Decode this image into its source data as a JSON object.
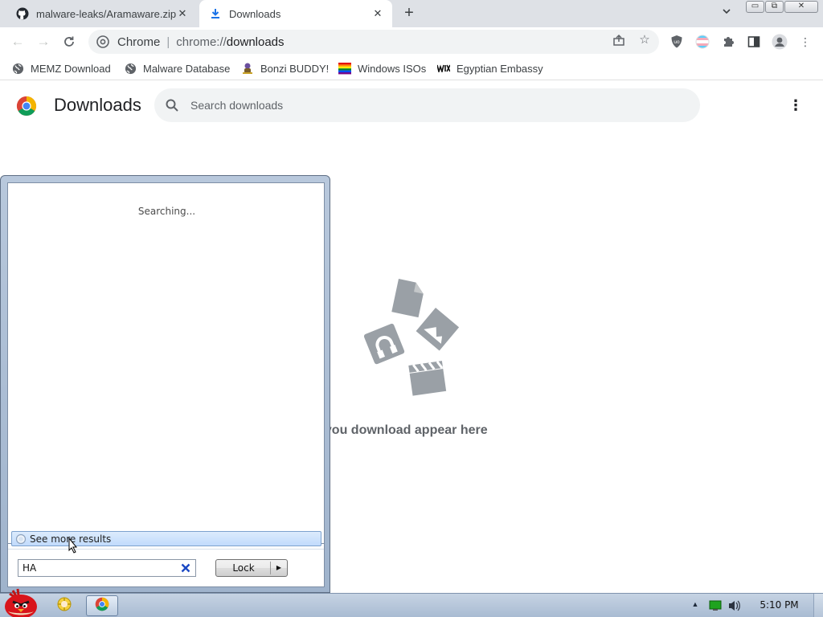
{
  "tabs": [
    {
      "title": "malware-leaks/Aramaware.zip",
      "icon": "github-icon",
      "active": false
    },
    {
      "title": "Downloads",
      "icon": "download-icon",
      "active": true
    }
  ],
  "window_controls": {
    "minimize": "▭",
    "restore": "⧉",
    "close": "✕"
  },
  "omnibox": {
    "chip": "Chrome",
    "separator": "|",
    "url_scheme": "chrome://",
    "url_host": "downloads"
  },
  "bookmarks": [
    {
      "label": "MEMZ Download",
      "icon": "globe-icon"
    },
    {
      "label": "Malware Database",
      "icon": "globe-icon"
    },
    {
      "label": "Bonzi BUDDY!",
      "icon": "bonzi-icon"
    },
    {
      "label": "Windows ISOs",
      "icon": "rainbow-flag-icon"
    },
    {
      "label": "Egyptian Embassy",
      "icon": "wix-icon"
    }
  ],
  "downloads": {
    "title": "Downloads",
    "search_placeholder": "Search downloads",
    "empty_text": "Files you download appear here"
  },
  "search_popup": {
    "status": "Searching...",
    "see_more": "See more results",
    "query": "HA",
    "lock_label": "Lock"
  },
  "taskbar": {
    "clock": "5:10 PM"
  },
  "colors": {
    "tab_strip": "#dee1e6",
    "omnibox_bg": "#f1f3f4",
    "accent_blue": "#1a73e8",
    "taskbar": "#b8c8dc"
  }
}
